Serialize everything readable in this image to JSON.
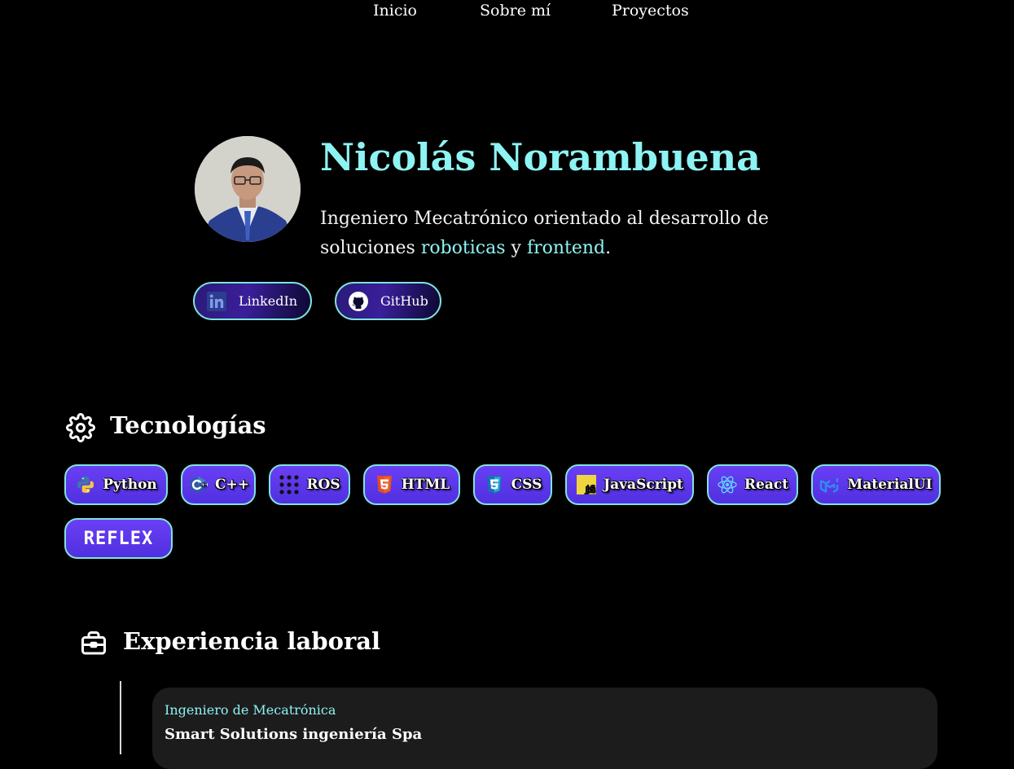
{
  "nav": {
    "items": [
      {
        "label": "Inicio"
      },
      {
        "label": "Sobre mí"
      },
      {
        "label": "Proyectos"
      }
    ]
  },
  "hero": {
    "name": "Nicolás Norambuena",
    "description": {
      "part1": "Ingeniero Mecatrónico orientado al desarrollo de soluciones ",
      "accent1": "roboticas",
      "part2": " y ",
      "accent2": "frontend",
      "part3": "."
    },
    "social": [
      {
        "label": "LinkedIn",
        "icon": "linkedin-icon"
      },
      {
        "label": "GitHub",
        "icon": "github-icon"
      }
    ]
  },
  "technologies": {
    "title": "Tecnologías",
    "icon": "gear-icon",
    "items": [
      {
        "label": "Python",
        "icon": "python-icon"
      },
      {
        "label": "C++",
        "icon": "cplusplus-icon"
      },
      {
        "label": "ROS",
        "icon": "ros-icon"
      },
      {
        "label": "HTML",
        "icon": "html5-icon"
      },
      {
        "label": "CSS",
        "icon": "css3-icon"
      },
      {
        "label": "JavaScript",
        "icon": "javascript-icon"
      },
      {
        "label": "React",
        "icon": "react-icon"
      },
      {
        "label": "MaterialUI",
        "icon": "materialui-icon"
      },
      {
        "label": "REFLEX",
        "icon": "reflex-logo"
      }
    ]
  },
  "experience": {
    "title": "Experiencia laboral",
    "icon": "briefcase-icon",
    "items": [
      {
        "role": "Ingeniero de Mecatrónica",
        "company": "Smart Solutions ingeniería Spa"
      }
    ]
  },
  "colors": {
    "accent": "#8ef3f3",
    "chip": "#5a36ec",
    "chip_border": "#7fe3de",
    "card": "#1c1c1c"
  }
}
